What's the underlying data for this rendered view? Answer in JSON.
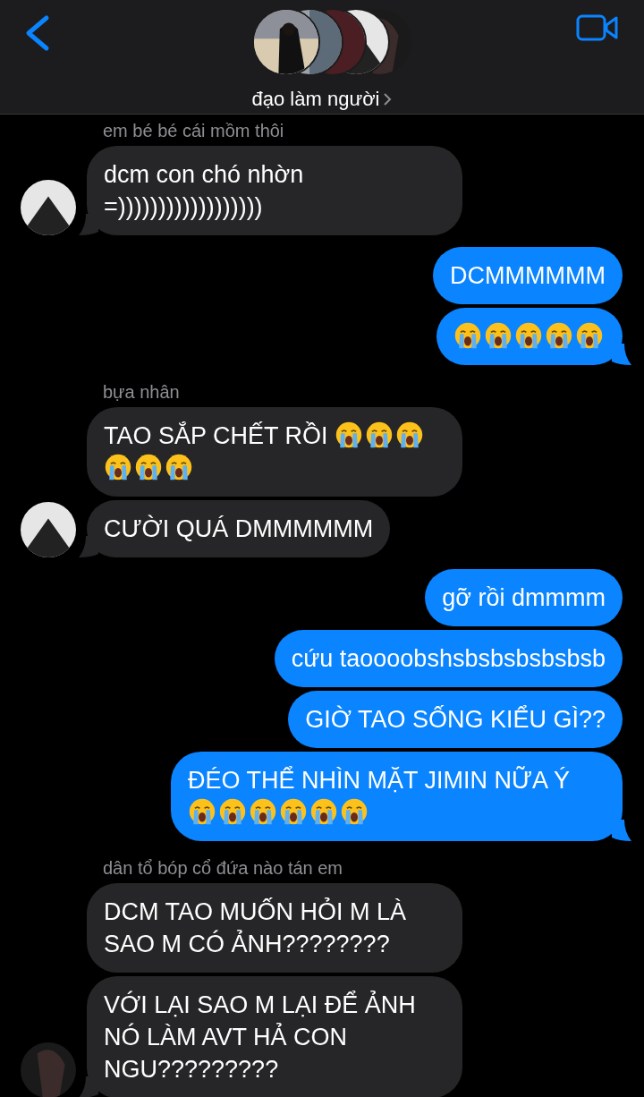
{
  "header": {
    "title": "đạo làm người"
  },
  "messages": [
    {
      "kind": "sender",
      "text": "em bé bé cái mồm thôi"
    },
    {
      "kind": "bubble",
      "outgoing": false,
      "text": "dcm con chó nhờn =))))))))))))))))))",
      "tail": true,
      "avatar": true
    },
    {
      "kind": "bubble",
      "outgoing": true,
      "text": "DCMMMMMM",
      "tail": false
    },
    {
      "kind": "bubble",
      "outgoing": true,
      "emojis": [
        {
          "kind": "crying"
        },
        {
          "kind": "crying"
        },
        {
          "kind": "crying"
        },
        {
          "kind": "crying"
        },
        {
          "kind": "crying"
        }
      ],
      "tail": true
    },
    {
      "kind": "sender",
      "text": "bựa nhân"
    },
    {
      "kind": "bubble",
      "outgoing": false,
      "text": "TAO SẮP CHẾT RỒI",
      "emojis": [
        {
          "kind": "crying"
        },
        {
          "kind": "crying"
        },
        {
          "kind": "crying"
        },
        {
          "kind": "crying"
        },
        {
          "kind": "crying"
        },
        {
          "kind": "crying"
        }
      ],
      "tail": false,
      "avatar": false
    },
    {
      "kind": "bubble",
      "outgoing": false,
      "text": "CƯỜI QUÁ DMMMMMM",
      "tail": true,
      "avatar": true
    },
    {
      "kind": "bubble",
      "outgoing": true,
      "text": "gỡ rồi dmmmm",
      "tail": false
    },
    {
      "kind": "bubble",
      "outgoing": true,
      "text": "cứu taoooobshsbsbsbsbsbsb",
      "tail": false
    },
    {
      "kind": "bubble",
      "outgoing": true,
      "text": "GIỜ TAO SỐNG KIỂU GÌ??",
      "tail": false
    },
    {
      "kind": "bubble",
      "outgoing": true,
      "text": "ĐÉO THỂ NHÌN MẶT JIMIN NỮA Ý",
      "emojis": [
        {
          "kind": "crying"
        },
        {
          "kind": "crying"
        },
        {
          "kind": "crying"
        },
        {
          "kind": "crying"
        },
        {
          "kind": "crying"
        },
        {
          "kind": "crying"
        }
      ],
      "tail": true
    },
    {
      "kind": "sender",
      "text": "dân tổ bóp cổ đứa nào tán em"
    },
    {
      "kind": "bubble",
      "outgoing": false,
      "text": "DCM TAO MUỐN HỎI M LÀ SAO M CÓ ẢNH????????",
      "tail": false,
      "avatar": false
    },
    {
      "kind": "bubble",
      "outgoing": false,
      "text": "VỚI LẠI SAO M LẠI ĐỂ ẢNH NÓ LÀM AVT HẢ CON NGU?????????",
      "tail": true,
      "avatar": true
    }
  ]
}
